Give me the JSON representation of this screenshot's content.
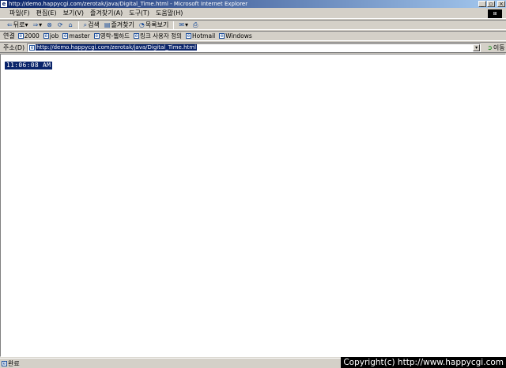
{
  "window": {
    "title": "http://demo.happycgi.com/zerotak/java/Digital_Time.html - Microsoft Internet Explorer",
    "minimize": "_",
    "maximize": "▫",
    "close": "×"
  },
  "menu": {
    "items": [
      "파일(F)",
      "편집(E)",
      "보기(V)",
      "즐겨찾기(A)",
      "도구(T)",
      "도움말(H)"
    ]
  },
  "toolbar": {
    "back": "뒤로",
    "forward": "",
    "search": "검색",
    "favorites": "즐겨찾기",
    "history": "목록보기"
  },
  "links": {
    "label": "연결",
    "items": [
      "2000",
      "job",
      "master",
      "영락-웹하드",
      "링크 사용자 정의",
      "Hotmail",
      "Windows"
    ]
  },
  "address": {
    "label": "주소(D)",
    "url": "http://demo.happycgi.com/zerotak/java/Digital_Time.html",
    "go": "이동"
  },
  "page": {
    "clock_time": "11:06:08 AM"
  },
  "status": {
    "text": "완료"
  },
  "watermark": {
    "text": "Copyright(c) http://www.happycgi.com"
  }
}
